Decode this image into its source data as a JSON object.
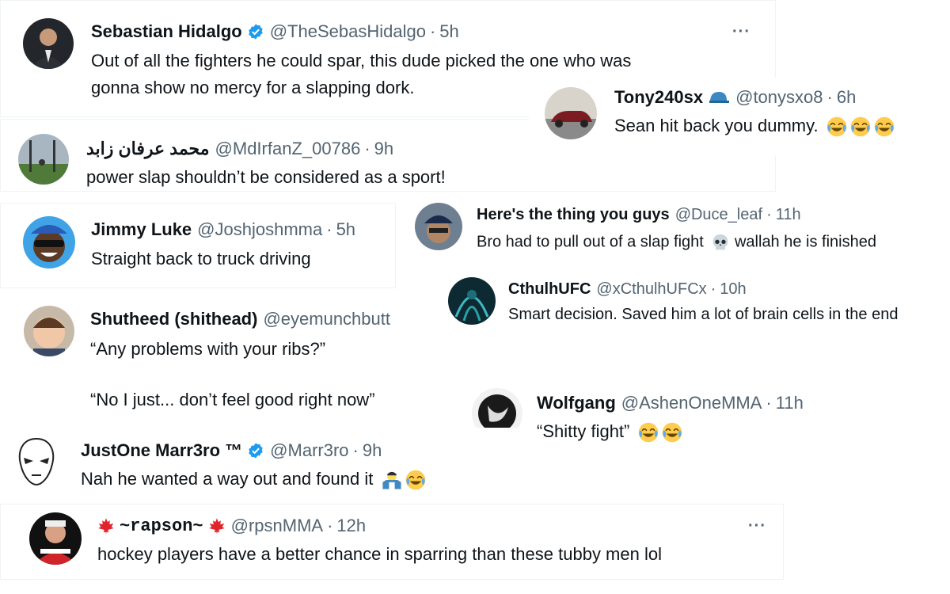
{
  "tweets": [
    {
      "name": "Sebastian Hidalgo",
      "handle": "@TheSebasHidalgo",
      "time": "5h",
      "lines": [
        "Out of all the fighters he could spar, this dude picked the one who was",
        "gonna show no mercy for a slapping dork."
      ]
    },
    {
      "name": "Tony240sx",
      "handle": "@tonysxo8",
      "time": "6h",
      "text": "Sean hit back you dummy."
    },
    {
      "name": "محمد عرفان زابد",
      "handle": "@MdIrfanZ_00786",
      "time": "9h",
      "text": "power slap shouldn’t be considered as a sport!"
    },
    {
      "name": "Jimmy Luke",
      "handle": "@Joshjoshmma",
      "time": "5h",
      "text": "Straight back to truck driving"
    },
    {
      "name": "Here's the thing you guys",
      "handle": "@Duce_leaf",
      "time": "11h",
      "text": "Bro had to pull out of a slap fight",
      "text2": "wallah he is finished"
    },
    {
      "name": "CthulhUFC",
      "handle": "@xCthulhUFCx",
      "time": "10h",
      "text": "Smart decision. Saved him a lot of brain cells in the end"
    },
    {
      "name": "Shutheed (shithead)",
      "handle": "@eyemunchbutt",
      "lines": [
        "“Any problems with your ribs?”",
        "“No I just... don’t feel good right now”"
      ]
    },
    {
      "name": "Wolfgang",
      "handle": "@AshenOneMMA",
      "time": "11h",
      "text": "“Shitty fight”"
    },
    {
      "name": "JustOne Marr3ro ™",
      "handle": "@Marr3ro",
      "time": "9h",
      "text": "Nah he wanted a way out and found it"
    },
    {
      "name": "~rapson~",
      "handle": "@rpsnMMA",
      "time": "12h",
      "text": "hockey players have a better chance in sparring than these tubby men lol"
    }
  ],
  "dot": "·",
  "more_label": "···",
  "icons": {
    "verified": "verified-badge-icon",
    "laugh": "face-with-tears-of-joy-emoji",
    "skull": "skull-emoji",
    "shrug": "man-shrugging-emoji",
    "cap": "blue-cap-emoji",
    "leaf": "maple-leaf-emoji"
  },
  "colors": {
    "verified": "#1d9bf0",
    "name": "#0f1419",
    "secondary": "#536471",
    "maple": "#e0242b"
  }
}
